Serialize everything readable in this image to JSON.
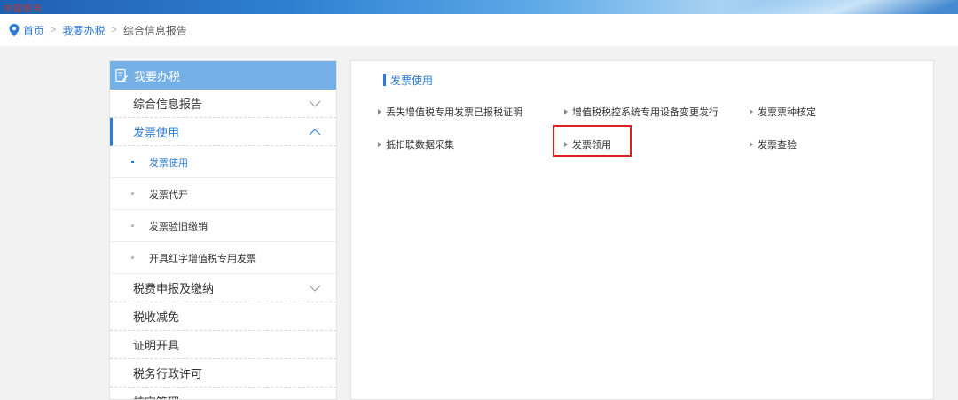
{
  "banner": {
    "logo_text": "中国税务"
  },
  "breadcrumb": {
    "home": "首页",
    "level1": "我要办税",
    "current": "综合信息报告",
    "separator": ">"
  },
  "sidebar": {
    "title": "我要办税",
    "items": [
      {
        "label": "综合信息报告"
      },
      {
        "label": "发票使用"
      }
    ],
    "sub_items": [
      {
        "label": "发票使用"
      },
      {
        "label": "发票代开"
      },
      {
        "label": "发票验旧缴销"
      },
      {
        "label": "开具红字增值税专用发票"
      }
    ],
    "items_after": [
      {
        "label": "税费申报及缴纳"
      },
      {
        "label": "税收减免"
      },
      {
        "label": "证明开具"
      },
      {
        "label": "税务行政许可"
      },
      {
        "label": "核定管理"
      }
    ]
  },
  "panel": {
    "title": "发票使用",
    "links": [
      {
        "label": "丢失增值税专用发票已报税证明"
      },
      {
        "label": "增值税税控系统专用设备变更发行"
      },
      {
        "label": "发票票种核定"
      },
      {
        "label": "抵扣联数据采集"
      },
      {
        "label": "发票领用"
      },
      {
        "label": "发票查验"
      }
    ]
  },
  "colors": {
    "accent": "#2e7bd6",
    "sidebar_header": "#74b0e6",
    "highlight": "#e02020"
  }
}
